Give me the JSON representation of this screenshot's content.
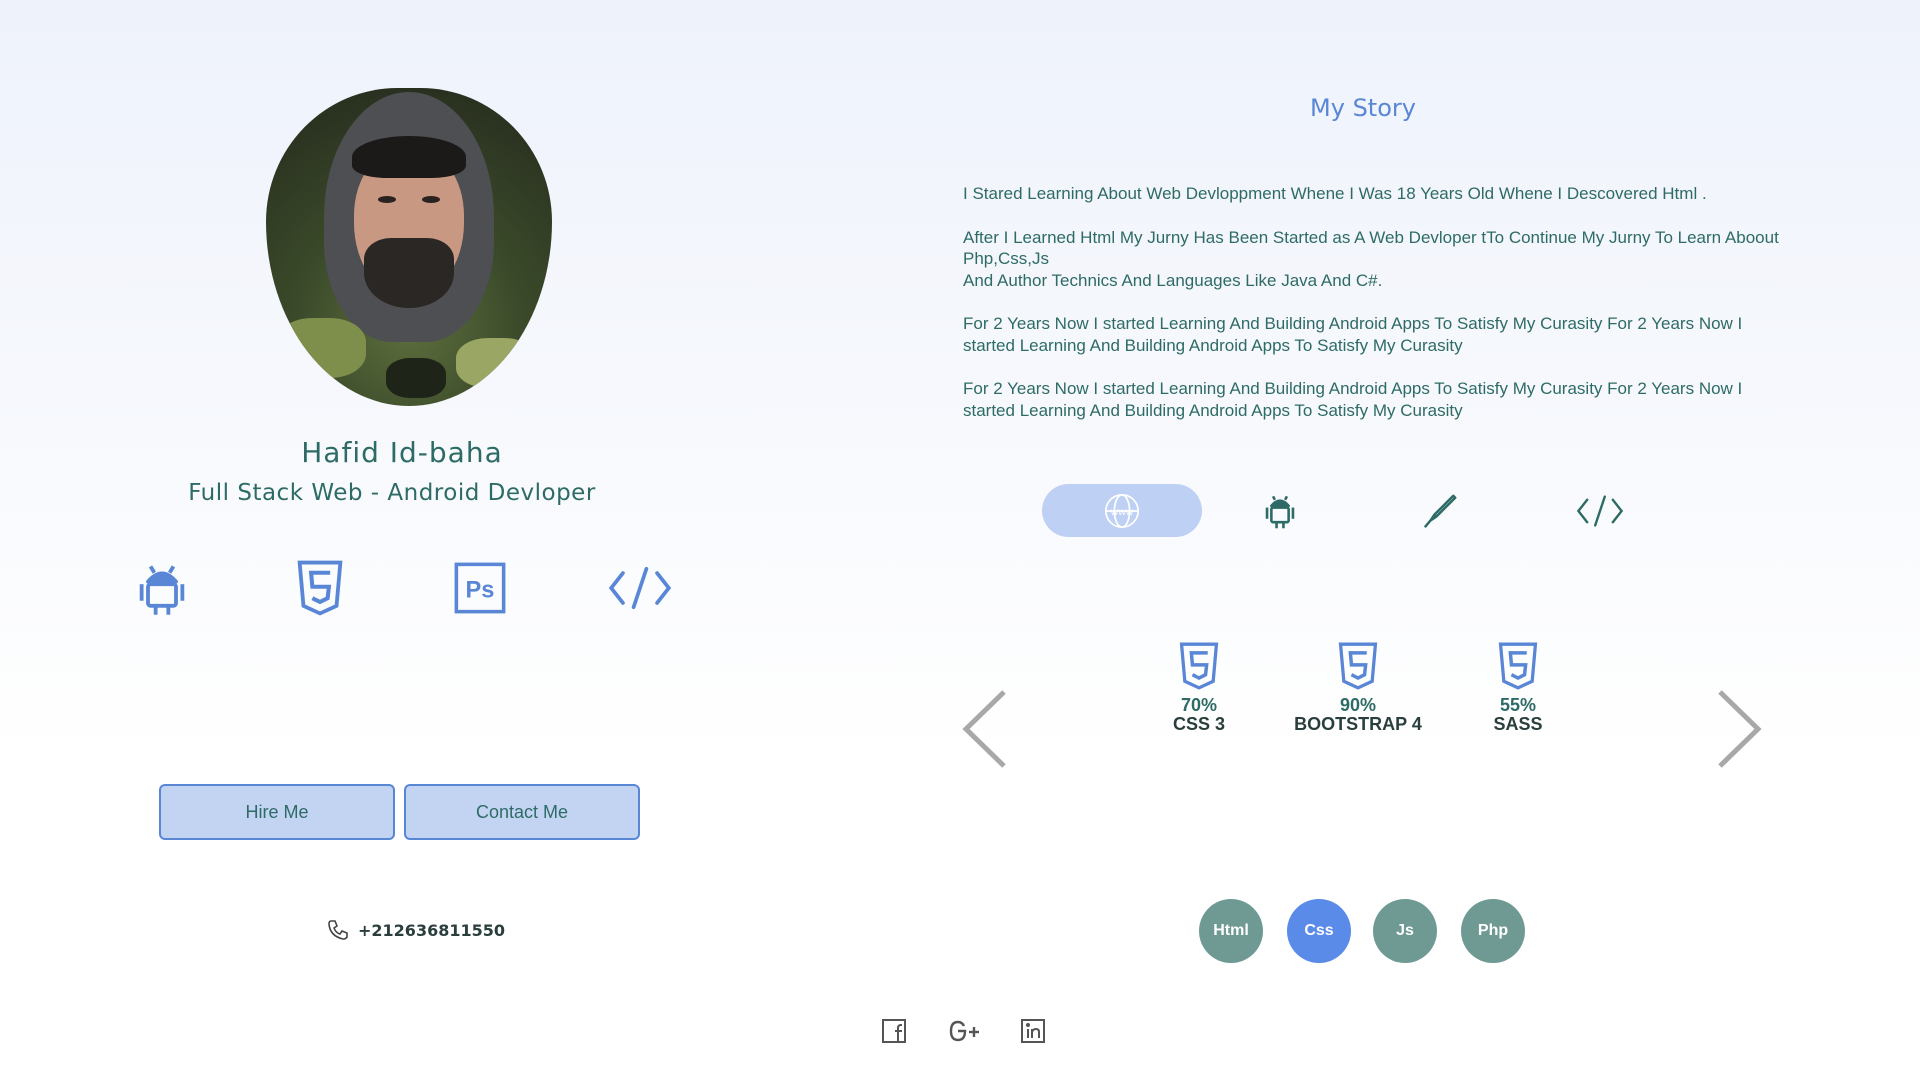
{
  "profile": {
    "name": "Hafid Id-baha",
    "title": "Full Stack Web - Android Devloper",
    "icons": [
      "android-icon",
      "html5-icon",
      "photoshop-icon",
      "code-icon"
    ],
    "hire_label": "Hire Me",
    "contact_label": "Contact Me",
    "phone": "+212636811550"
  },
  "story": {
    "title": "My Story",
    "paragraphs": [
      "I Stared Learning  About Web Devloppment Whene I Was 18 Years Old Whene I Descovered Html .",
      "After I Learned Html My Jurny Has Been  Started as A Web Devloper  tTo Continue My Jurny To Learn Aboout Php,Css,Js\nAnd Author Technics And Languages Like Java And C#.",
      "For 2 Years Now I started Learning And Building Android Apps To Satisfy My Curasity  For 2 Years Now I started Learning And Building Android Apps To Satisfy My Curasity",
      "For 2 Years Now I started Learning And Building Android Apps To Satisfy My Curasity  For 2 Years Now I started Learning And Building Android Apps To Satisfy My Curasity"
    ]
  },
  "tabs": [
    {
      "icon": "www-globe-icon",
      "active": true
    },
    {
      "icon": "android-icon",
      "active": false
    },
    {
      "icon": "pen-icon",
      "active": false
    },
    {
      "icon": "code-icon",
      "active": false
    }
  ],
  "skills": [
    {
      "percent": "70%",
      "label": "CSS 3",
      "icon": "html5-icon"
    },
    {
      "percent": "90%",
      "label": "BOOTSTRAP 4",
      "icon": "html5-icon"
    },
    {
      "percent": "55%",
      "label": "SASS",
      "icon": "html5-icon"
    }
  ],
  "pager": [
    {
      "label": "Html",
      "active": false
    },
    {
      "label": "Css",
      "active": true
    },
    {
      "label": "Js",
      "active": false
    },
    {
      "label": "Php",
      "active": false
    }
  ],
  "social": [
    "facebook-icon",
    "google-plus-icon",
    "linkedin-icon"
  ],
  "colors": {
    "accent": "#5a86d6",
    "text": "#2e6b66",
    "button_bg": "#c3d4f3",
    "pager_inactive": "#6f9a94",
    "pager_active": "#5a8be8"
  }
}
